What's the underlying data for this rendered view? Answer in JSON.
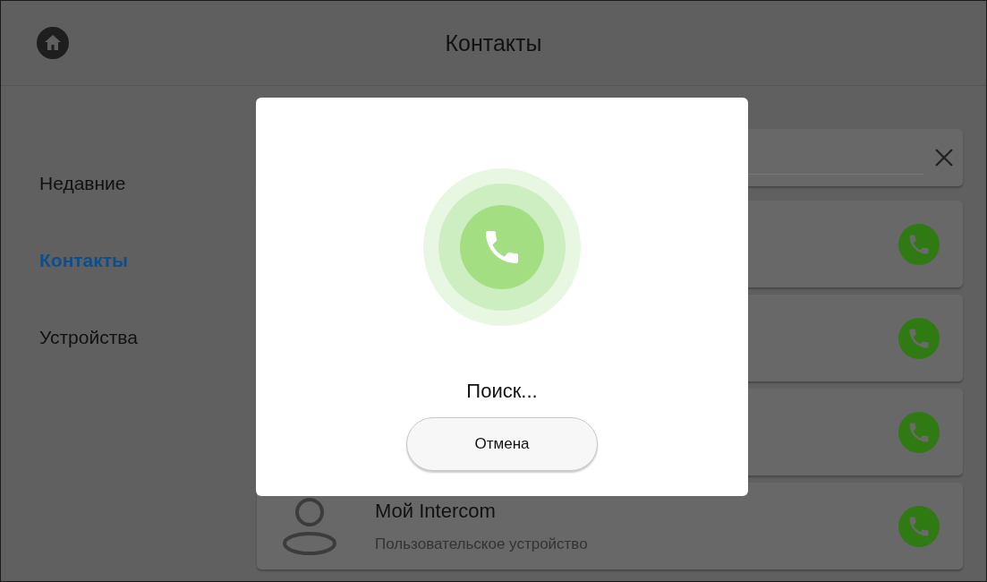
{
  "header": {
    "title": "Контакты"
  },
  "sidebar": {
    "items": [
      {
        "label": "Недавние",
        "selected": false
      },
      {
        "label": "Контакты",
        "selected": true
      },
      {
        "label": "Устройства",
        "selected": false
      }
    ]
  },
  "contacts": [
    {
      "name": "Мой Intercom",
      "detail": "Пользовательское устройство"
    }
  ],
  "dialog": {
    "status": "Поиск...",
    "cancel_label": "Отмена"
  }
}
